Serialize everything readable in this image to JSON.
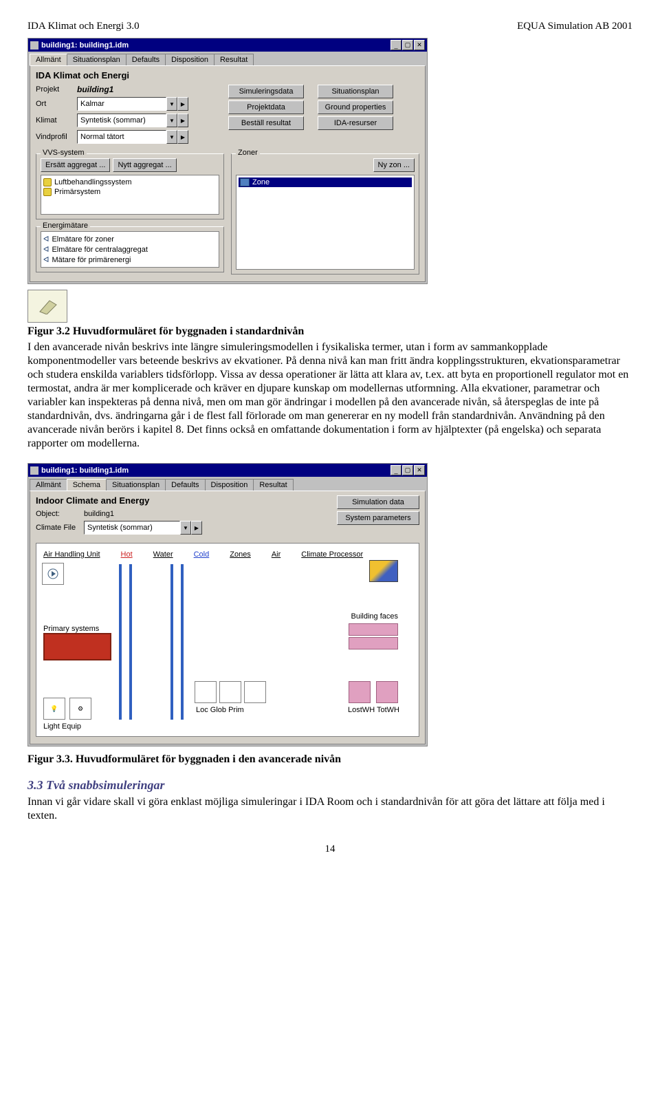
{
  "header": {
    "left": "IDA Klimat och Energi 3.0",
    "right": "EQUA Simulation AB 2001"
  },
  "win1": {
    "title": "building1: building1.idm",
    "tabs": [
      "Allmänt",
      "Situationsplan",
      "Defaults",
      "Disposition",
      "Resultat"
    ],
    "panel_title": "IDA Klimat och Energi",
    "labels": {
      "projekt": "Projekt",
      "ort": "Ort",
      "klimat": "Klimat",
      "vindprofil": "Vindprofil"
    },
    "fields": {
      "projekt": "building1",
      "ort": "Kalmar",
      "klimat": "Syntetisk (sommar)",
      "vindprofil": "Normal tätort"
    },
    "buttons": {
      "simdata": "Simuleringsdata",
      "projdata": "Projektdata",
      "bestall": "Beställ resultat",
      "sitplan": "Situationsplan",
      "ground": "Ground properties",
      "idares": "IDA-resurser"
    },
    "group_vvs_title": "VVS-system",
    "group_vvs_btns": {
      "ersatt": "Ersätt aggregat ...",
      "nytt": "Nytt aggregat ..."
    },
    "vvs_items": [
      "Luftbehandlingssystem",
      "Primärsystem"
    ],
    "group_zoner_title": "Zoner",
    "group_zoner_btn": "Ny zon ...",
    "zone_item": "Zone",
    "group_energi_title": "Energimätare",
    "energi_items": [
      "Elmätare för zoner",
      "Elmätare för centralaggregat",
      "Mätare för primärenergi"
    ]
  },
  "caption1": "Figur 3.2 Huvudformuläret för byggnaden i standardnivån",
  "para1": "I den avancerade nivån beskrivs inte längre simuleringsmodellen i fysikaliska termer, utan i form av sammankopplade komponentmodeller vars beteende beskrivs av ekvationer. På denna nivå kan man fritt ändra kopplingsstrukturen, ekvationsparametrar och studera enskilda variablers tidsförlopp. Vissa av dessa operationer är lätta att klara av, t.ex. att byta en proportionell regulator mot en termostat, andra är mer komplicerade och kräver en djupare kunskap om modellernas utformning. Alla ekvationer, parametrar och variabler kan inspekteras på denna nivå, men om man gör ändringar i modellen på den avancerade nivån, så återspeglas de inte på standardnivån, dvs. ändringarna går i de flest fall förlorade om man genererar en ny modell från standardnivån. Användning på den avancerade nivån berörs i kapitel 8. Det finns också en omfattande dokumentation i form av hjälptexter (på engelska) och separata rapporter om modellerna.",
  "win2": {
    "title": "building1: building1.idm",
    "tabs": [
      "Allmänt",
      "Schema",
      "Situationsplan",
      "Defaults",
      "Disposition",
      "Resultat"
    ],
    "panel_title": "Indoor Climate and Energy",
    "labels": {
      "object": "Object:",
      "climfile": "Climate File"
    },
    "fields": {
      "object": "building1",
      "climfile": "Syntetisk (sommar)"
    },
    "buttons": {
      "simdata": "Simulation data",
      "sysparam": "System parameters"
    },
    "header_links": {
      "ahu": "Air Handling Unit",
      "hot": "Hot",
      "water": "Water",
      "cold": "Cold",
      "zones": "Zones",
      "air": "Air",
      "climproc": "Climate Processor"
    },
    "side_labels": {
      "primary": "Primary systems",
      "light": "Light Equip",
      "bfaces": "Building faces"
    },
    "bottom_labels": {
      "loc_glob_prim": "Loc  Glob Prim",
      "lost_tot": "LostWH  TotWH"
    }
  },
  "caption2": "Figur 3.3. Huvudformuläret för byggnaden i den avancerade nivån",
  "section_title": "3.3  Två snabbsimuleringar",
  "para2": "Innan vi går vidare skall vi göra enklast möjliga simuleringar i IDA Room och i standardnivån för att göra det lättare att följa med i texten.",
  "page_num": "14"
}
